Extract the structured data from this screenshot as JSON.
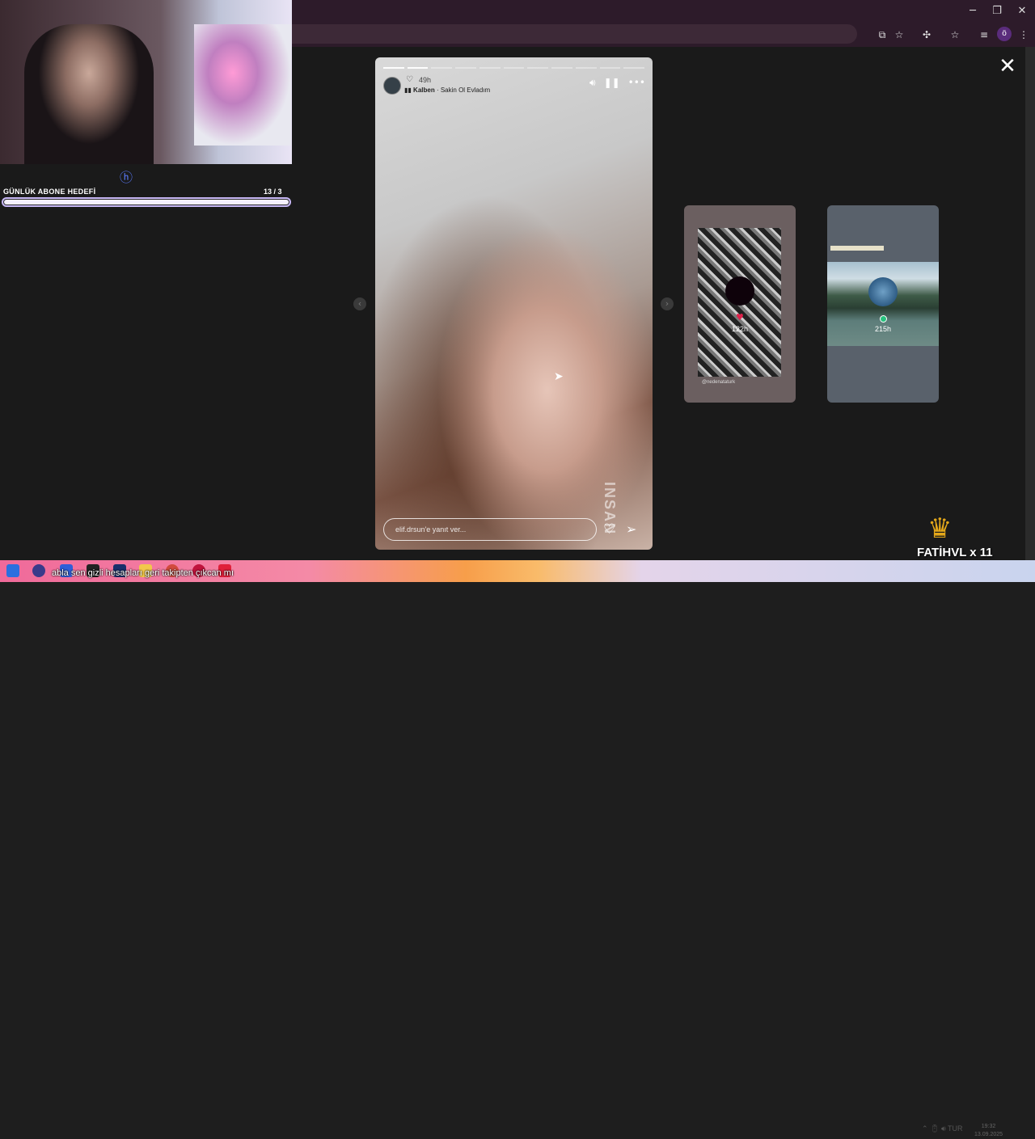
{
  "window": {
    "minimize": "─",
    "restore": "❐",
    "close": "✕"
  },
  "toolbar": {
    "icons": [
      "install-icon",
      "star-icon",
      "extensions-icon",
      "bookmark-icon",
      "media-icon"
    ],
    "profile_initial": "ö",
    "menu": "⋮"
  },
  "stream": {
    "goal_label": "GÜNLÜK ABONE HEDEFİ",
    "goal_count": "13  / 3",
    "goal_progress": 1.0,
    "sub_label": "FATİHVL x 11"
  },
  "story": {
    "time": "49h",
    "music_artist": "Kalben",
    "music_song": " · Sakin Ol Evladım",
    "reply_placeholder": "elif.drsun'e yanıt ver...",
    "watermark": "INSAN",
    "segments": 11,
    "active_segment": 2
  },
  "previews": [
    {
      "time": "122h",
      "handle": "@nedenataturk"
    },
    {
      "time": "215h"
    }
  ],
  "taskbar": {
    "chat_text": "abla sen gizli hesapları geri takipten çıkcan mı",
    "clock_time": "19:32",
    "clock_date": "13.09.2025",
    "tray_lang": "TUR"
  }
}
